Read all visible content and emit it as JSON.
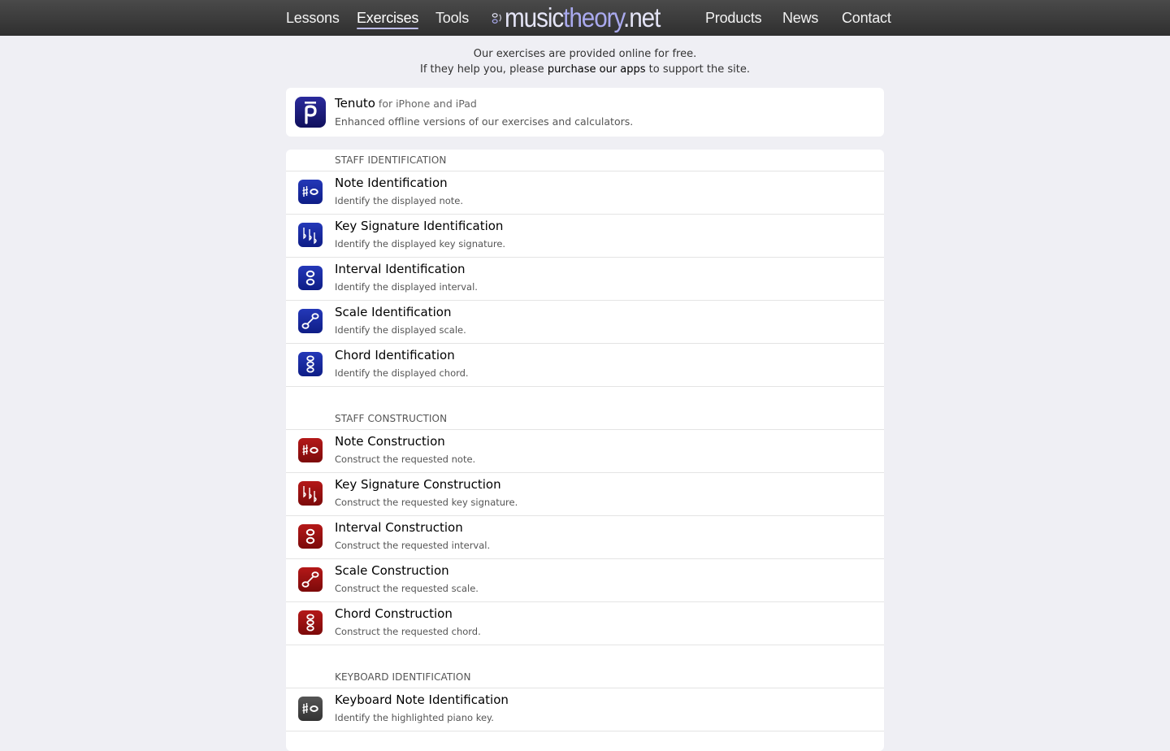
{
  "nav": {
    "left": [
      "Lessons",
      "Exercises",
      "Tools"
    ],
    "right": [
      "Products",
      "News",
      "Contact"
    ],
    "active": "Exercises",
    "logo": {
      "part1": "music",
      "part2": "theory",
      "part3": ".net"
    }
  },
  "intro": {
    "line1": "Our exercises are provided online for free.",
    "line2_pre": "If they help you, please ",
    "line2_link": "purchase our apps",
    "line2_post": " to support the site."
  },
  "promo": {
    "title": "Tenuto",
    "subtitle": "for iPhone and iPad",
    "desc": "Enhanced offline versions of our exercises and calculators."
  },
  "sections": [
    {
      "title": "STAFF IDENTIFICATION",
      "items": [
        {
          "title": "Note Identification",
          "desc": "Identify the displayed note.",
          "icon": "note-icon",
          "color": "blue"
        },
        {
          "title": "Key Signature Identification",
          "desc": "Identify the displayed key signature.",
          "icon": "key-signature-icon",
          "color": "blue"
        },
        {
          "title": "Interval Identification",
          "desc": "Identify the displayed interval.",
          "icon": "interval-icon",
          "color": "blue"
        },
        {
          "title": "Scale Identification",
          "desc": "Identify the displayed scale.",
          "icon": "scale-icon",
          "color": "blue"
        },
        {
          "title": "Chord Identification",
          "desc": "Identify the displayed chord.",
          "icon": "chord-icon",
          "color": "blue"
        }
      ]
    },
    {
      "title": "STAFF CONSTRUCTION",
      "items": [
        {
          "title": "Note Construction",
          "desc": "Construct the requested note.",
          "icon": "note-icon",
          "color": "red"
        },
        {
          "title": "Key Signature Construction",
          "desc": "Construct the requested key signature.",
          "icon": "key-signature-icon",
          "color": "red"
        },
        {
          "title": "Interval Construction",
          "desc": "Construct the requested interval.",
          "icon": "interval-icon",
          "color": "red"
        },
        {
          "title": "Scale Construction",
          "desc": "Construct the requested scale.",
          "icon": "scale-icon",
          "color": "red"
        },
        {
          "title": "Chord Construction",
          "desc": "Construct the requested chord.",
          "icon": "chord-icon",
          "color": "red"
        }
      ]
    },
    {
      "title": "KEYBOARD IDENTIFICATION",
      "items": [
        {
          "title": "Keyboard Note Identification",
          "desc": "Identify the highlighted piano key.",
          "icon": "note-icon",
          "color": "gray"
        }
      ]
    }
  ],
  "colors": {
    "nav_bg": "#3a3a3a",
    "page_bg": "#efeff4",
    "blue": "#1a2a9e",
    "red": "#9a1010",
    "gray": "#444444",
    "logo_accent": "#a9a9ee"
  }
}
